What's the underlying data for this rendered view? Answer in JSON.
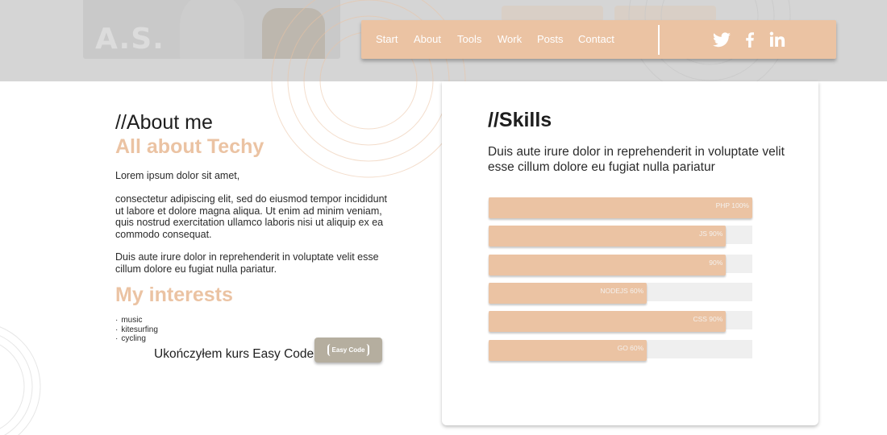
{
  "header": {
    "logo": "A.S.",
    "nav": [
      "Start",
      "About",
      "Tools",
      "Work",
      "Posts",
      "Contact"
    ],
    "social_icons": [
      "twitter-icon",
      "facebook-icon",
      "linkedin-icon"
    ]
  },
  "about": {
    "title": "//About me",
    "subtitle": "All about Techy",
    "paragraphs": [
      "Lorem ipsum dolor sit amet,",
      "consectetur adipiscing elit, sed do eiusmod tempor incididunt ut labore et dolore magna aliqua. Ut enim ad minim veniam, quis nostrud exercitation ullamco laboris nisi ut aliquip ex ea commodo consequat.",
      "Duis aute irure dolor in reprehenderit in voluptate velit esse cillum dolore eu fugiat nulla pariatur."
    ],
    "interests_title": "My interests",
    "interests": [
      "music",
      "kitesurfing",
      "cycling"
    ],
    "course_text": "Ukończyłem kurs Easy Code",
    "course_badge": "Easy Code"
  },
  "skills": {
    "title": "//Skills",
    "description": "Duis aute irure dolor in reprehenderit in voluptate velit esse cillum dolore eu fugiat nulla pariatur",
    "bars": [
      {
        "label": "PHP 100%",
        "percent": 100
      },
      {
        "label": "JS 90%",
        "percent": 90
      },
      {
        "label": "90%",
        "percent": 90
      },
      {
        "label": "NODEJS 60%",
        "percent": 60
      },
      {
        "label": "CSS 90%",
        "percent": 90
      },
      {
        "label": "GO 60%",
        "percent": 60
      }
    ]
  },
  "colors": {
    "accent": "#ebc3a3",
    "header_bg": "#d5d5d5",
    "track": "#efefef",
    "badge": "#b5ae9f"
  }
}
